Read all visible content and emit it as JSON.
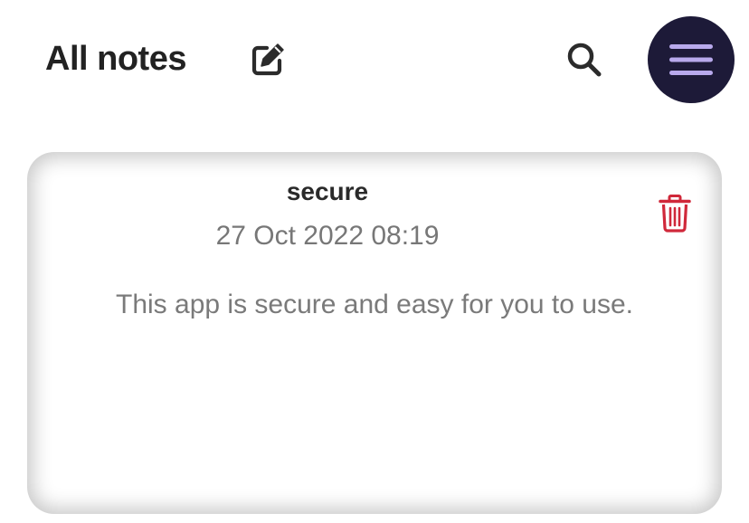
{
  "header": {
    "title": "All notes",
    "edit_icon": "edit-note-icon",
    "search_icon": "search-icon",
    "menu_icon": "hamburger-menu-icon"
  },
  "notes": [
    {
      "title": "secure",
      "date": "27 Oct 2022 08:19",
      "body": "This app is secure and easy for you to use.",
      "delete_icon": "trash-icon"
    }
  ],
  "colors": {
    "menu_button_bg": "#1d1a38",
    "menu_lines": "#b8a9ec",
    "delete_icon": "#d0283a",
    "title_text": "#222222",
    "secondary_text": "#777777"
  }
}
